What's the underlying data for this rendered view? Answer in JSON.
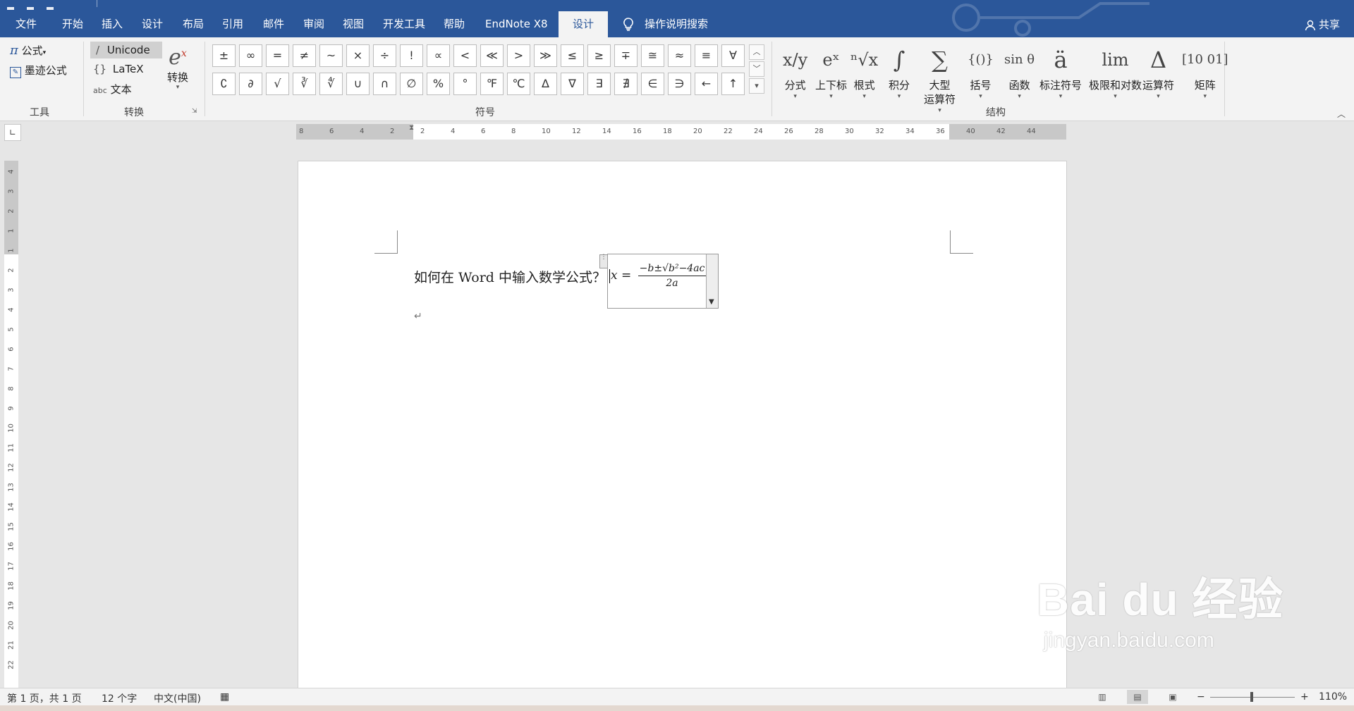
{
  "tabs": [
    {
      "label": "文件"
    },
    {
      "label": "开始"
    },
    {
      "label": "插入"
    },
    {
      "label": "设计"
    },
    {
      "label": "布局"
    },
    {
      "label": "引用"
    },
    {
      "label": "邮件"
    },
    {
      "label": "审阅"
    },
    {
      "label": "视图"
    },
    {
      "label": "开发工具"
    },
    {
      "label": "帮助"
    },
    {
      "label": "EndNote X8"
    },
    {
      "label": "设计",
      "active": true
    }
  ],
  "search_hint": "操作说明搜索",
  "share_label": "共享",
  "ribbon": {
    "tools": {
      "equation_label": "公式",
      "ink_label": "墨迹公式",
      "group_label": "工具"
    },
    "convert": {
      "unicode_label": "Unicode",
      "latex_label": "LaTeX",
      "text_label": "文本",
      "text_prefix": "abc",
      "convert_button_label": "转换",
      "group_label": "转换"
    },
    "symbols": {
      "row1": [
        "±",
        "∞",
        "=",
        "≠",
        "~",
        "×",
        "÷",
        "!",
        "∝",
        "<",
        "≪",
        ">",
        "≫",
        "≤",
        "≥",
        "∓",
        "≅",
        "≈",
        "≡",
        "∀"
      ],
      "row2": [
        "∁",
        "∂",
        "√",
        "∛",
        "∜",
        "∪",
        "∩",
        "∅",
        "%",
        "°",
        "℉",
        "℃",
        "∆",
        "∇",
        "∃",
        "∄",
        "∈",
        "∋",
        "←",
        "↑"
      ],
      "group_label": "符号"
    },
    "structures": {
      "items": [
        {
          "glyph": "x/y",
          "label": "分式"
        },
        {
          "glyph": "eˣ",
          "label": "上下标"
        },
        {
          "glyph": "ⁿ√x",
          "label": "根式"
        },
        {
          "glyph": "∫",
          "label": "积分"
        },
        {
          "glyph": "∑",
          "label": "大型\n运算符"
        },
        {
          "glyph": "{()}",
          "label": "括号"
        },
        {
          "glyph": "sin θ",
          "label": "函数"
        },
        {
          "glyph": "ä",
          "label": "标注符号"
        },
        {
          "glyph": "lim",
          "label": "极限和对数"
        },
        {
          "glyph": "Δ",
          "label": "运算符"
        },
        {
          "glyph": "[10 01]",
          "label": "矩阵"
        }
      ],
      "group_label": "结构"
    }
  },
  "ruler": {
    "h_numbers": [
      "8",
      "6",
      "4",
      "2",
      "2",
      "4",
      "6",
      "8",
      "10",
      "12",
      "14",
      "16",
      "18",
      "20",
      "22",
      "24",
      "26",
      "28",
      "30",
      "32",
      "34",
      "36",
      "40",
      "42",
      "44"
    ],
    "v_numbers": [
      "4",
      "3",
      "2",
      "1",
      "1",
      "2",
      "3",
      "4",
      "5",
      "6",
      "7",
      "8",
      "9",
      "10",
      "11",
      "12",
      "13",
      "14",
      "15",
      "16",
      "17",
      "18",
      "19",
      "20",
      "21",
      "22"
    ]
  },
  "document": {
    "text_before_equation": "如何在 Word 中输入数学公式？",
    "equation": {
      "lhs": "x =",
      "numerator": "−b±√b²−4ac",
      "denominator": "2a"
    },
    "paragraph_mark": "↵"
  },
  "watermark": {
    "brand": "Bai  du 经验",
    "url": "jingyan.baidu.com"
  },
  "statusbar": {
    "page_info": "第 1 页，共 1 页",
    "word_count": "12 个字",
    "language": "中文(中国)",
    "zoom_minus": "−",
    "zoom_plus": "+",
    "zoom_level": "110%"
  }
}
